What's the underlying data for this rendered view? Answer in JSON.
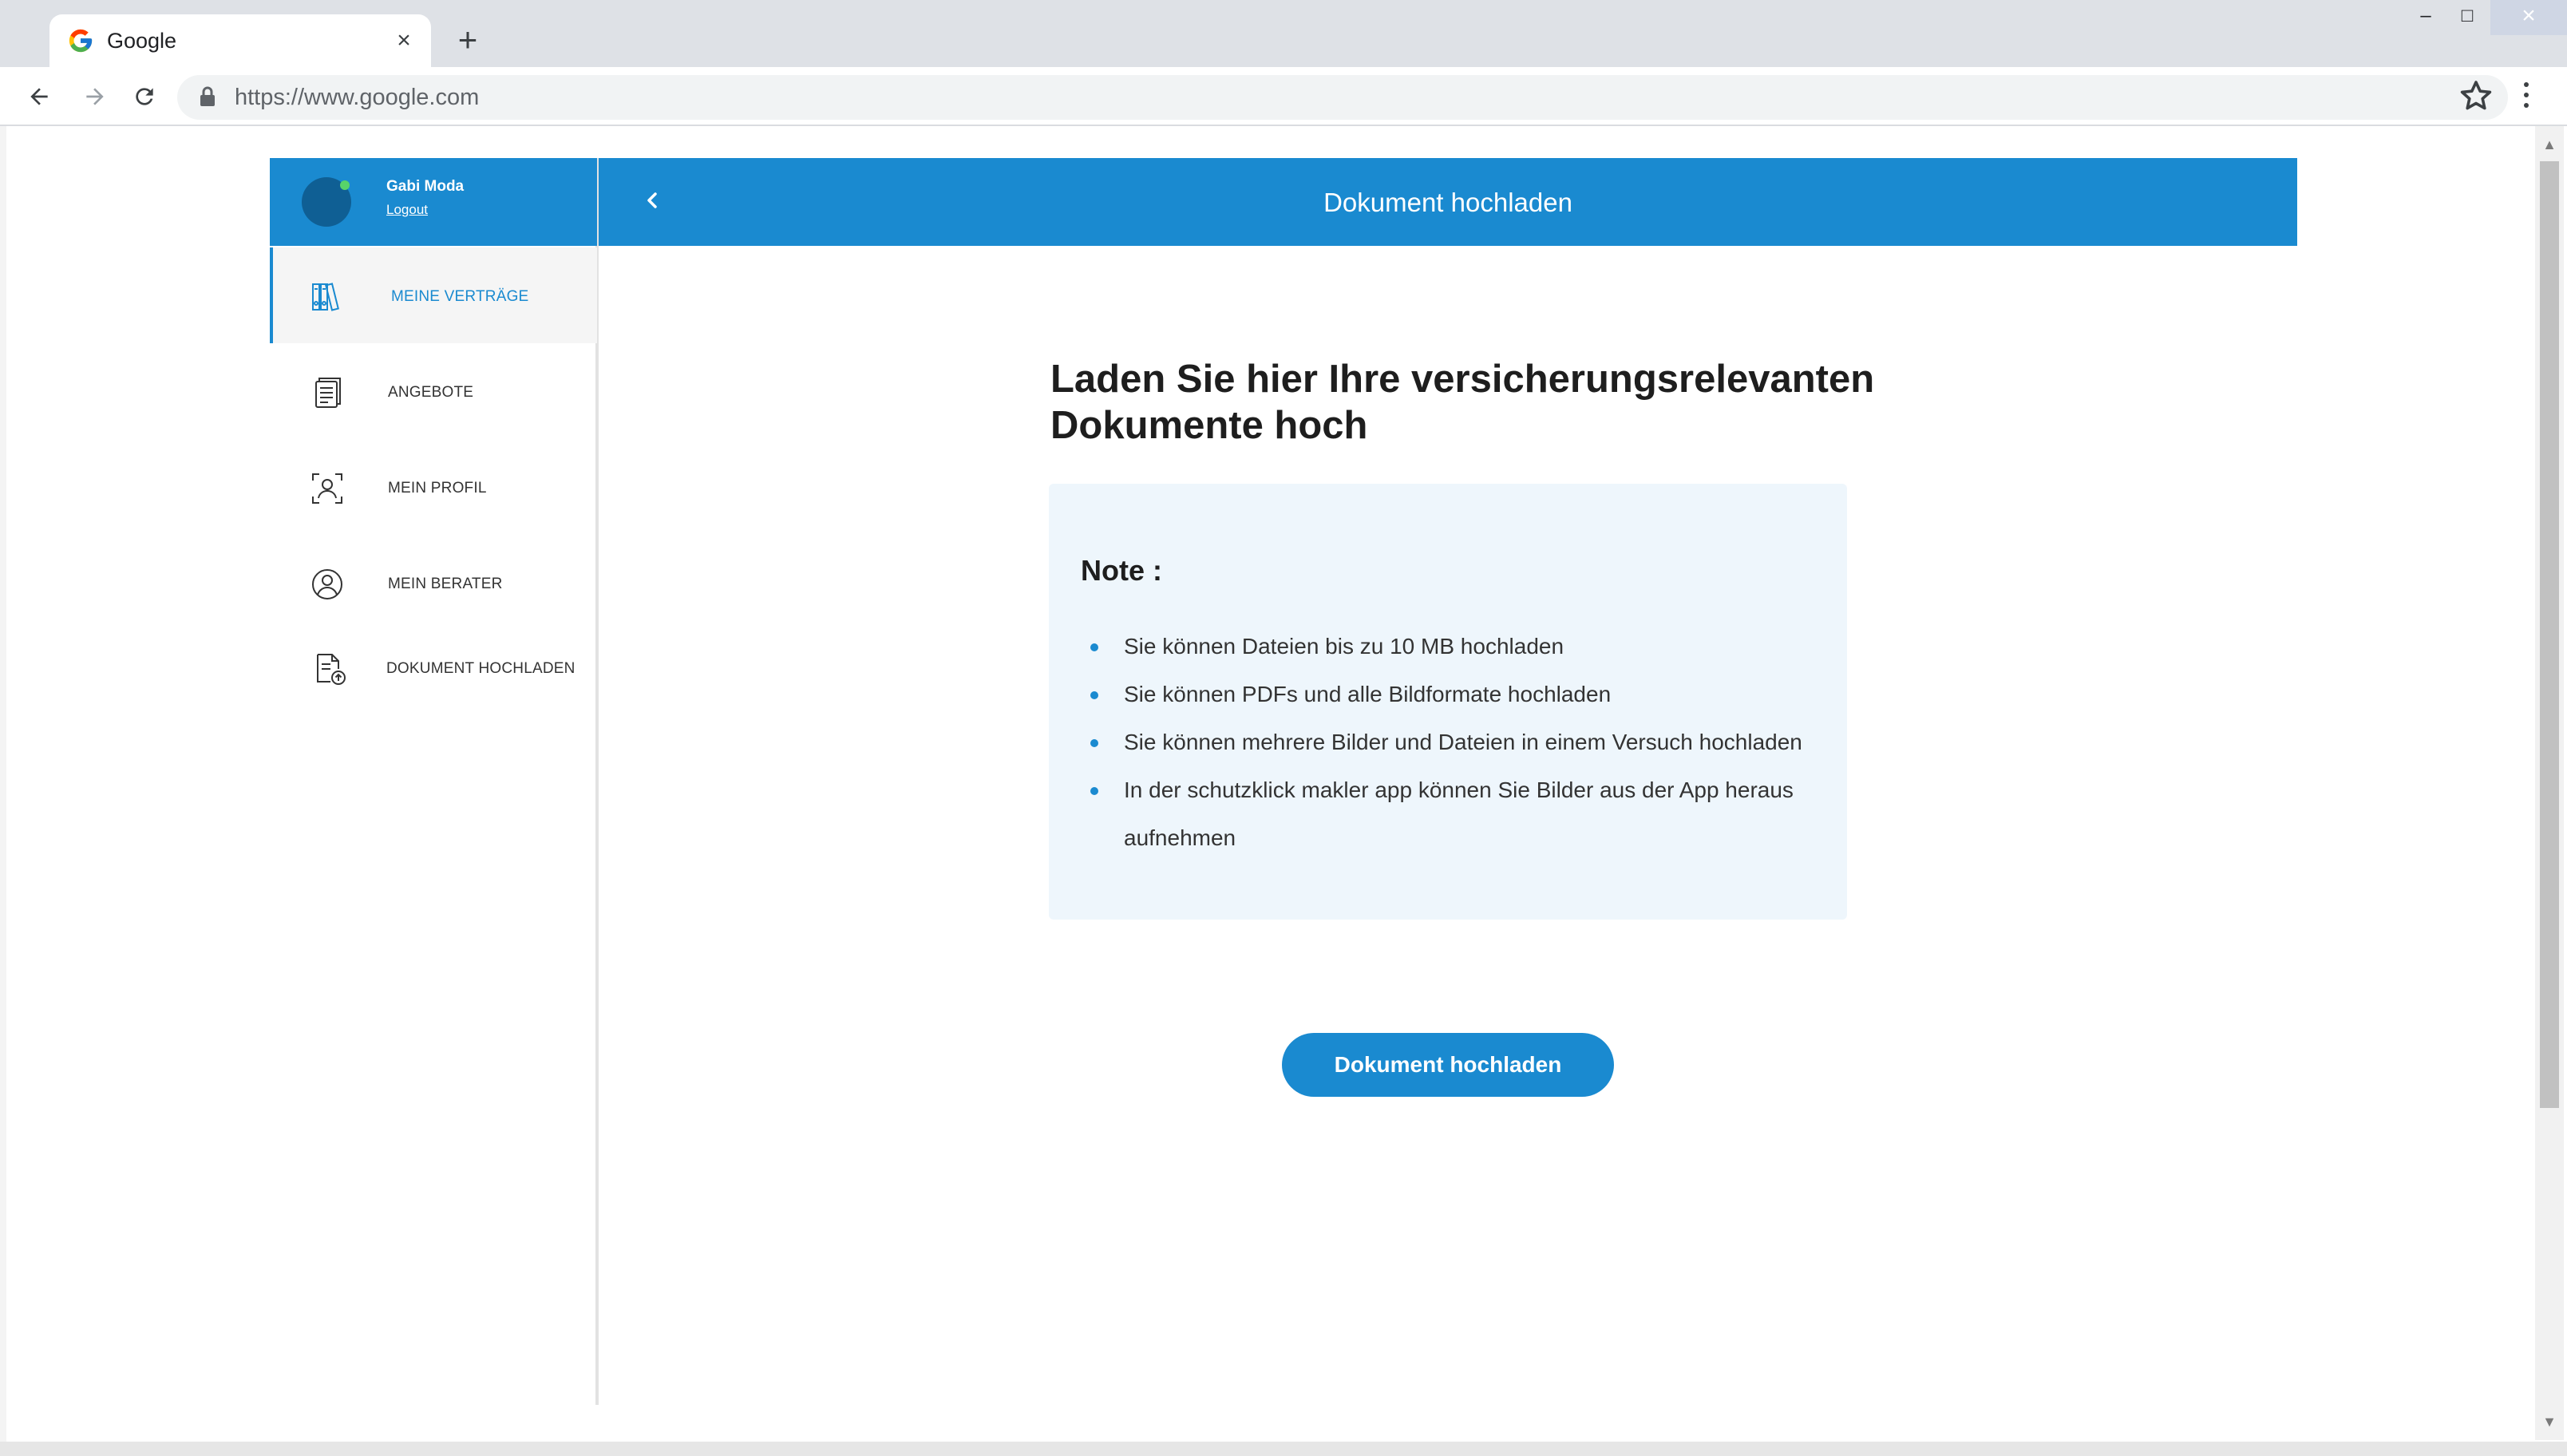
{
  "browser": {
    "tab_title": "Google",
    "new_tab_symbol": "+",
    "close_tab_symbol": "×",
    "url": "https://www.google.com",
    "window_controls": {
      "minimize": "–",
      "maximize": "□",
      "close": "×"
    },
    "icons": [
      "google-favicon",
      "back-arrow-icon",
      "forward-arrow-icon",
      "reload-icon",
      "lock-icon",
      "star-icon",
      "kebab-menu-icon"
    ]
  },
  "profile": {
    "name": "Gabi Moda",
    "logout_label": "Logout",
    "status_color": "#57d36a"
  },
  "sidebar": {
    "items": [
      {
        "label": "MEINE VERTRÄGE",
        "icon": "binders-icon",
        "active": true
      },
      {
        "label": "ANGEBOTE",
        "icon": "document-list-icon",
        "active": false
      },
      {
        "label": "MEIN PROFIL",
        "icon": "profile-scan-icon",
        "active": false
      },
      {
        "label": "MEIN BERATER",
        "icon": "advisor-icon",
        "active": false
      },
      {
        "label": "DOKUMENT HOCHLADEN",
        "icon": "document-upload-icon",
        "active": false
      }
    ]
  },
  "header": {
    "title": "Dokument hochladen",
    "back_icon": "chevron-left-icon"
  },
  "main": {
    "headline": "Laden Sie hier Ihre versicherungsrelevanten Dokumente hoch",
    "note": {
      "title": "Note :",
      "items": [
        "Sie können Dateien bis zu 10 MB hochladen",
        "Sie können PDFs und alle Bildformate hochladen",
        "Sie können mehrere Bilder und Dateien in einem Versuch hochladen",
        "In der schutzklick makler app können Sie Bilder aus der App heraus aufnehmen"
      ]
    },
    "upload_button_label": "Dokument hochladen"
  },
  "colors": {
    "brand": "#1a8ad0",
    "note_background": "#eef6fc",
    "active_nav_background": "#f5f5f5"
  }
}
